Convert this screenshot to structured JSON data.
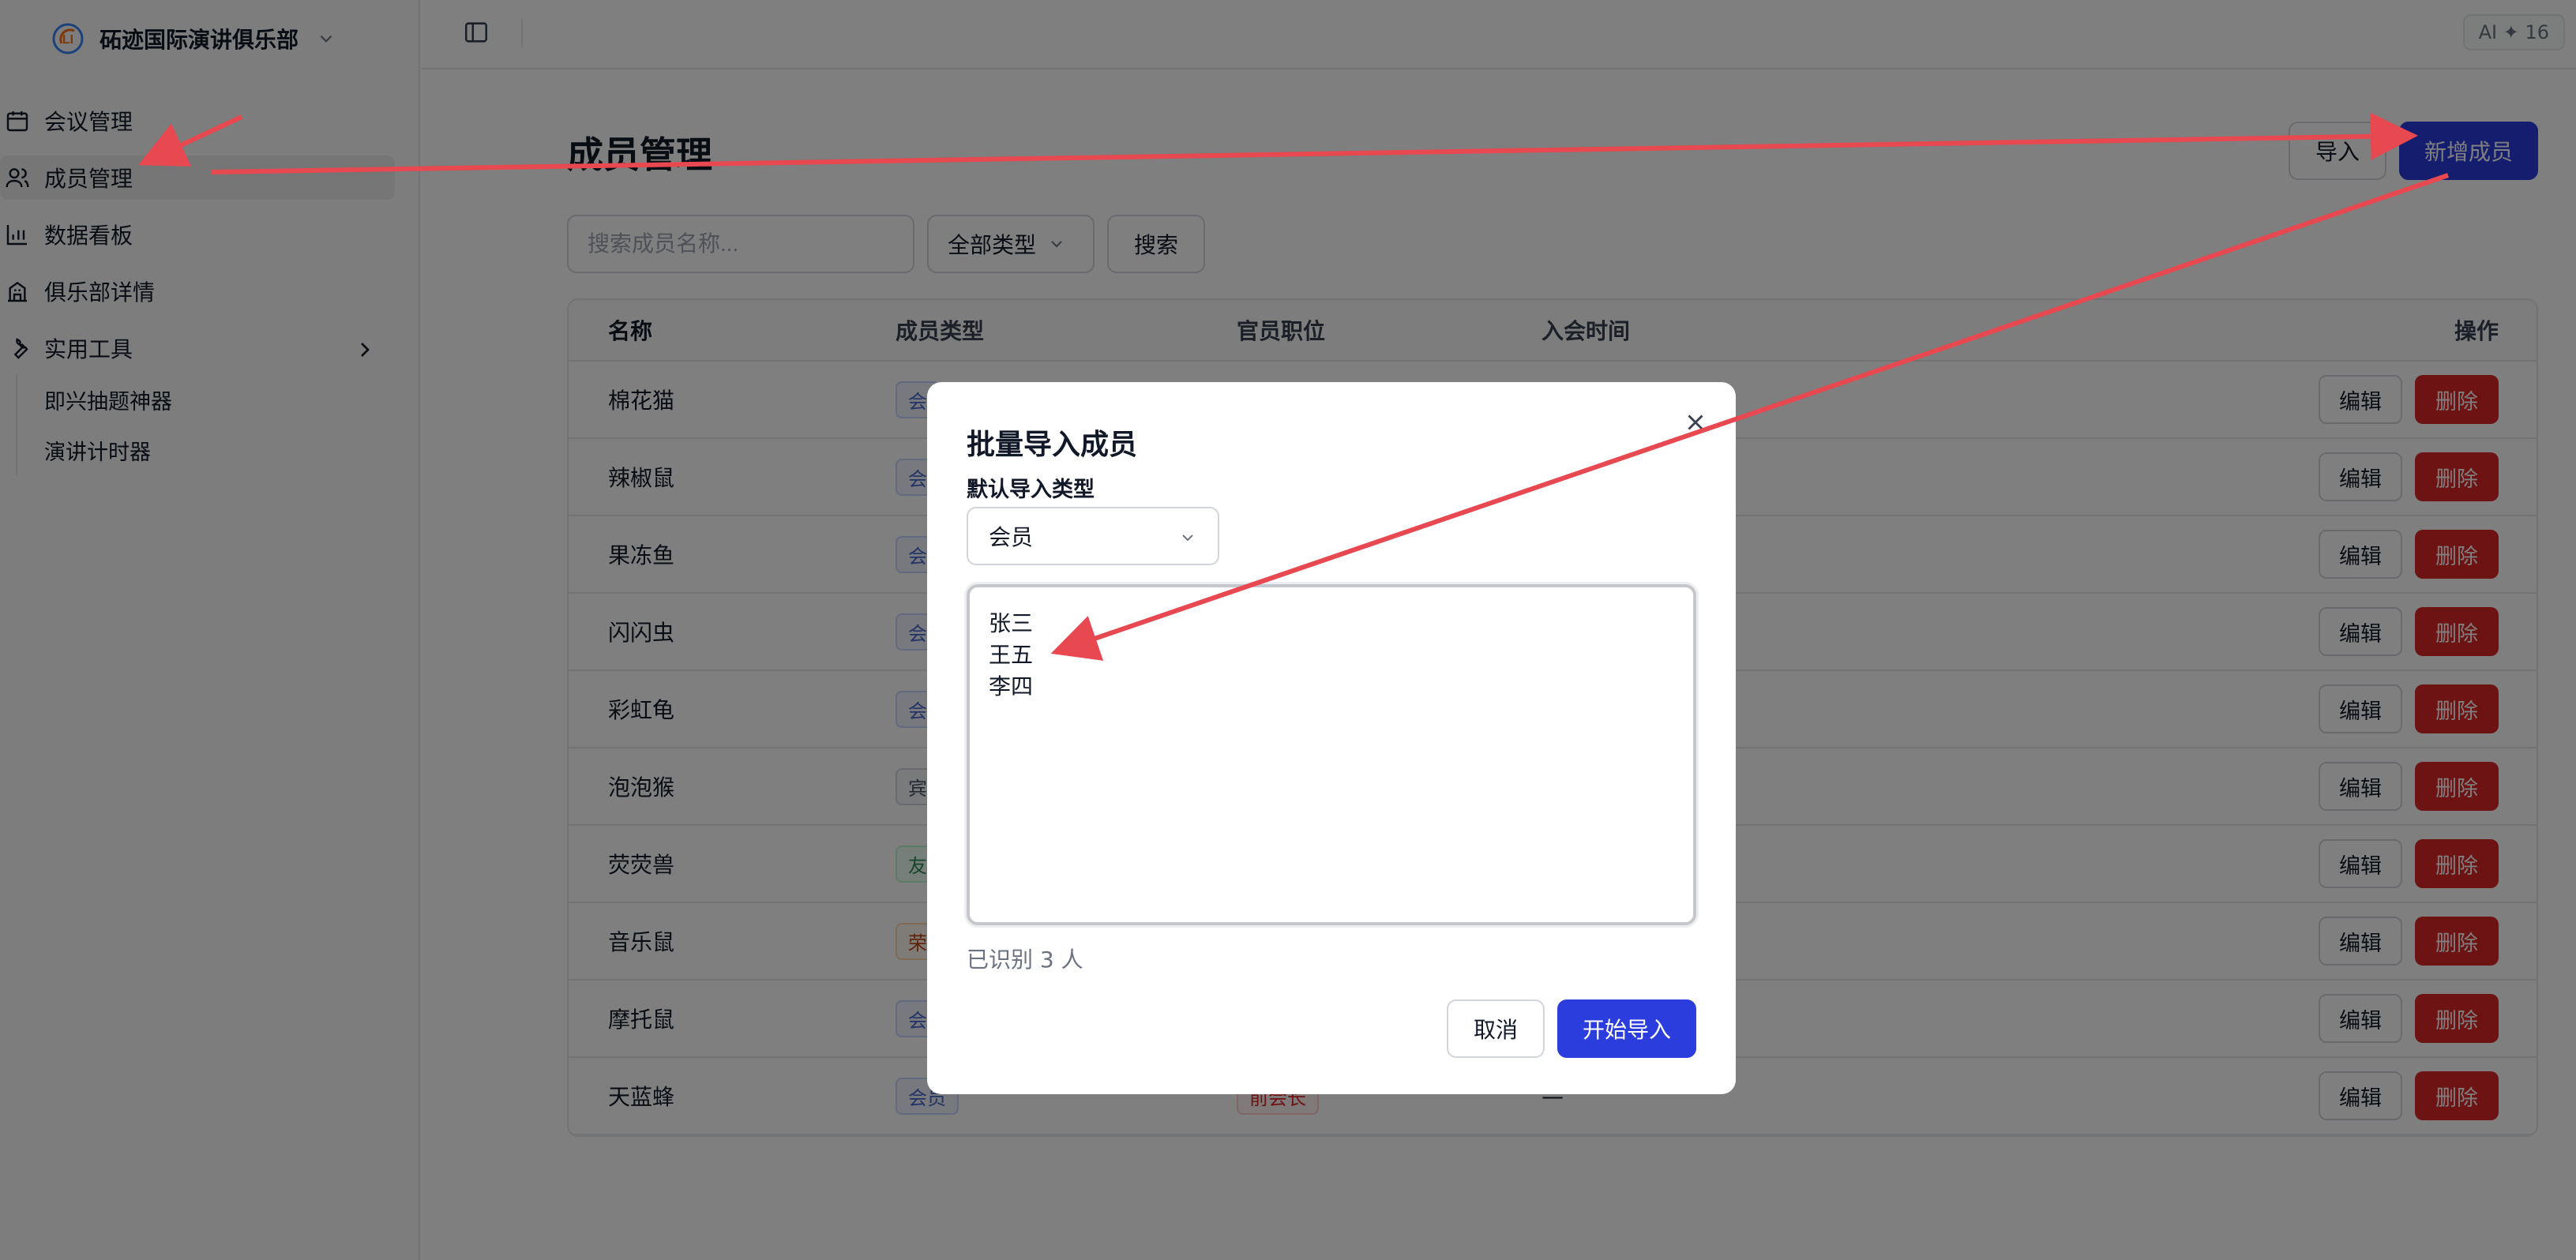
{
  "org": {
    "name": "砳迹国际演讲俱乐部",
    "logo_icon": "club-logo"
  },
  "sidebar": {
    "items": [
      {
        "label": "会议管理",
        "icon": "calendar-icon"
      },
      {
        "label": "成员管理",
        "icon": "users-icon",
        "active": true
      },
      {
        "label": "数据看板",
        "icon": "bar-chart-icon"
      },
      {
        "label": "俱乐部详情",
        "icon": "building-icon"
      },
      {
        "label": "实用工具",
        "icon": "wrench-icon"
      }
    ],
    "subitems": [
      {
        "label": "即兴抽题神器"
      },
      {
        "label": "演讲计时器"
      }
    ]
  },
  "topbar": {
    "ai_badge": "AI ✦ 16"
  },
  "page": {
    "title": "成员管理",
    "import_label": "导入",
    "add_label": "新增成员",
    "search_placeholder": "搜索成员名称...",
    "type_filter": "全部类型",
    "search_button": "搜索"
  },
  "table": {
    "headers": {
      "name": "名称",
      "type": "成员类型",
      "role": "官员职位",
      "join": "入会时间",
      "ops": "操作"
    },
    "edit_label": "编辑",
    "delete_label": "删除",
    "rows": [
      {
        "name": "棉花猫",
        "type": "会",
        "tag": "blue"
      },
      {
        "name": "辣椒鼠",
        "type": "会",
        "tag": "blue"
      },
      {
        "name": "果冻鱼",
        "type": "会",
        "tag": "blue"
      },
      {
        "name": "闪闪虫",
        "type": "会",
        "tag": "blue"
      },
      {
        "name": "彩虹龟",
        "type": "会",
        "tag": "blue"
      },
      {
        "name": "泡泡猴",
        "type": "宾",
        "tag": "gray"
      },
      {
        "name": "荧荧兽",
        "type": "友",
        "tag": "green"
      },
      {
        "name": "音乐鼠",
        "type": "荣",
        "tag": "orange"
      },
      {
        "name": "摩托鼠",
        "type": "会",
        "tag": "blue"
      },
      {
        "name": "天蓝蜂",
        "type": "会员",
        "tag": "blue",
        "role": "前会长",
        "join": "—"
      }
    ]
  },
  "dialog": {
    "title": "批量导入成员",
    "type_label": "默认导入类型",
    "type_value": "会员",
    "textarea_value": "张三\n王五\n李四",
    "hint": "已识别 3 人",
    "cancel": "取消",
    "start": "开始导入"
  },
  "colors": {
    "primary": "#2b3ddc",
    "danger": "#dc2626",
    "annotation": "#e84850"
  }
}
